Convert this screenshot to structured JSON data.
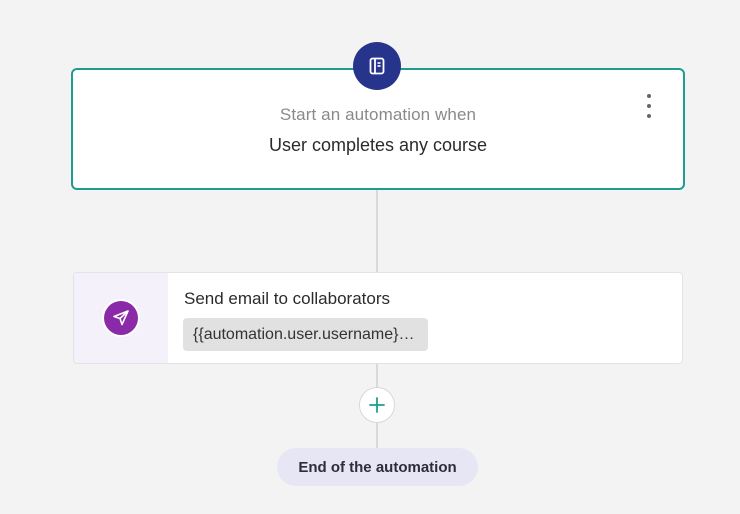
{
  "trigger": {
    "icon": "notebook-icon",
    "subtitle": "Start an automation when",
    "title": "User completes any course"
  },
  "action": {
    "icon": "send-icon",
    "title": "Send email to collaborators",
    "chip_text": "{{automation.user.username}}…"
  },
  "add_step": {
    "icon": "plus-icon"
  },
  "end": {
    "label": "End of the automation"
  },
  "colors": {
    "background": "#f3f3f3",
    "trigger_border": "#1f9c8f",
    "trigger_icon_bg": "#27348b",
    "action_icon_bg": "#8b2aa8",
    "action_icon_panel": "#f4f1fa",
    "add_icon": "#1f9c8f",
    "end_pill_bg": "#e7e6f4"
  }
}
